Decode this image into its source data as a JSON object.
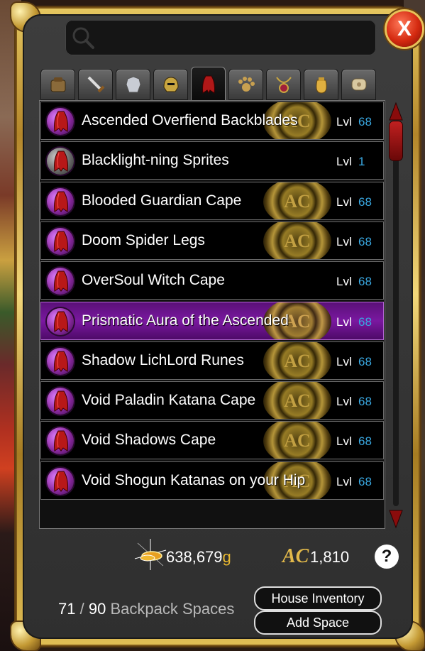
{
  "window": {
    "close_label": "X",
    "search": {
      "placeholder": ""
    }
  },
  "tabs": [
    {
      "name": "bag-tab",
      "icon": "bag-icon",
      "active": false
    },
    {
      "name": "weapon-tab",
      "icon": "sword-icon",
      "active": false
    },
    {
      "name": "armor-tab",
      "icon": "armor-icon",
      "active": false
    },
    {
      "name": "helm-tab",
      "icon": "helm-icon",
      "active": false
    },
    {
      "name": "cape-tab",
      "icon": "cape-icon",
      "active": true
    },
    {
      "name": "pet-tab",
      "icon": "paw-icon",
      "active": false
    },
    {
      "name": "necklace-tab",
      "icon": "necklace-icon",
      "active": false
    },
    {
      "name": "item-bag-tab",
      "icon": "sack-icon",
      "active": false
    },
    {
      "name": "misc-tab",
      "icon": "scroll-icon",
      "active": false
    }
  ],
  "items": [
    {
      "name": "Ascended Overfiend Backblades",
      "lvl_label": "Lvl",
      "level": "68",
      "ac": true,
      "selected": false,
      "icon_color": "purple"
    },
    {
      "name": "Blacklight-ning Sprites",
      "lvl_label": "Lvl",
      "level": "1",
      "ac": false,
      "selected": false,
      "icon_color": "gray"
    },
    {
      "name": "Blooded Guardian Cape",
      "lvl_label": "Lvl",
      "level": "68",
      "ac": true,
      "selected": false,
      "icon_color": "purple"
    },
    {
      "name": "Doom Spider Legs",
      "lvl_label": "Lvl",
      "level": "68",
      "ac": true,
      "selected": false,
      "icon_color": "purple"
    },
    {
      "name": "OverSoul Witch Cape",
      "lvl_label": "Lvl",
      "level": "68",
      "ac": false,
      "selected": false,
      "icon_color": "purple"
    },
    {
      "name": "Prismatic Aura of the Ascended",
      "lvl_label": "Lvl",
      "level": "68",
      "ac": true,
      "selected": true,
      "icon_color": "purple"
    },
    {
      "name": "Shadow LichLord Runes",
      "lvl_label": "Lvl",
      "level": "68",
      "ac": true,
      "selected": false,
      "icon_color": "purple"
    },
    {
      "name": "Void Paladin Katana Cape",
      "lvl_label": "Lvl",
      "level": "68",
      "ac": true,
      "selected": false,
      "icon_color": "purple"
    },
    {
      "name": "Void Shadows Cape",
      "lvl_label": "Lvl",
      "level": "68",
      "ac": true,
      "selected": false,
      "icon_color": "purple"
    },
    {
      "name": "Void Shogun Katanas on your Hip",
      "lvl_label": "Lvl",
      "level": "68",
      "ac": true,
      "selected": false,
      "icon_color": "purple"
    }
  ],
  "ac_seal_text": "AC",
  "scrollbar": {
    "position": 0.0
  },
  "footer": {
    "gold_value": "638,679",
    "gold_unit": "g",
    "ac_symbol": "AC",
    "ac_value": "1,810",
    "help_label": "?",
    "backpack_used": "71",
    "backpack_sep": "/",
    "backpack_total": "90",
    "backpack_label": "Backpack Spaces",
    "house_inventory_label": "House Inventory",
    "add_space_label": "Add Space"
  },
  "colors": {
    "level_number": "#39a7e0",
    "selected_row": "#7a18a0",
    "frame_gold": "#d4aa40",
    "close_red": "#d42a10",
    "gold_unit": "#e8b830"
  }
}
